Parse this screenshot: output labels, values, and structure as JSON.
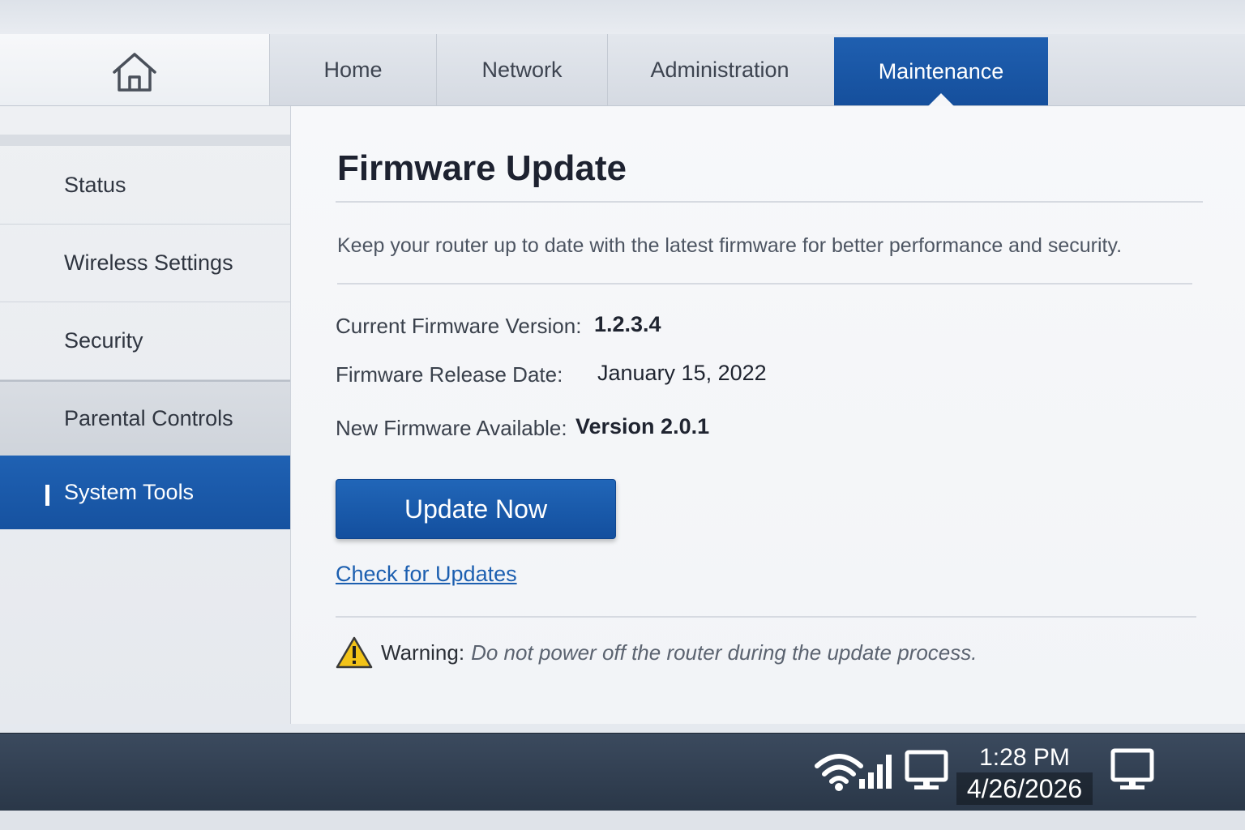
{
  "nav": {
    "tabs": [
      {
        "label": "Home"
      },
      {
        "label": "Network"
      },
      {
        "label": "Administration"
      },
      {
        "label": "Maintenance"
      }
    ],
    "active_tab": "Maintenance"
  },
  "sidebar": {
    "items": [
      {
        "label": "Status"
      },
      {
        "label": "Wireless Settings"
      },
      {
        "label": "Security"
      },
      {
        "label": "Parental Controls"
      },
      {
        "label": "System Tools"
      }
    ],
    "active_item": "System Tools"
  },
  "main": {
    "title": "Firmware Update",
    "description": "Keep your router up to date with the latest firmware for better performance and security.",
    "current_version_label": "Current Firmware Version:",
    "current_version_value": "1.2.3.4",
    "release_date_label": "Firmware Release Date:",
    "release_date_value": "January 15, 2022",
    "new_firmware_label": "New Firmware Available:",
    "new_firmware_value": "Version 2.0.1",
    "update_button_label": "Update Now",
    "check_link_label": "Check for Updates",
    "warning_label": "Warning:",
    "warning_text": "Do not power off the router during the update process."
  },
  "taskbar": {
    "time": "1:28 PM",
    "date": "4/26/2026",
    "icons": [
      "wifi-icon",
      "signal-bars-icon",
      "monitor-icon",
      "desktop-icon"
    ]
  },
  "colors": {
    "accent": "#1a5aaa",
    "link": "#1c5fb0",
    "warning": "#f2c318",
    "taskbar": "#2f3d50"
  }
}
